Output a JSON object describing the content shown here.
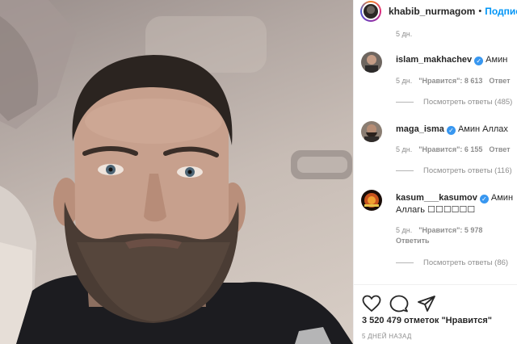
{
  "post": {
    "photo_alt": "selfie photo"
  },
  "header": {
    "username": "khabib_nurmagom",
    "separator": "•",
    "follow_label": "Подпис"
  },
  "top_comment_age": "5 дн.",
  "comments": [
    {
      "username": "islam_makhachev",
      "text": "Амин",
      "text2": "",
      "age": "5 дн.",
      "likes": "\"Нравится\": 8 613",
      "reply": "Ответ",
      "view_replies": "Посмотреть ответы (485)"
    },
    {
      "username": "maga_isma",
      "text": "Амин Аллах",
      "text2": "",
      "age": "5 дн.",
      "likes": "\"Нравится\": 6 155",
      "reply": "Ответ",
      "view_replies": "Посмотреть ответы (116)"
    },
    {
      "username": "kasum___kasumov",
      "text": "Амин",
      "text2": "Аллагь ☐☐☐☐☐☐",
      "age": "5 дн.",
      "likes": "\"Нравится\": 5 978",
      "reply": "Ответить",
      "view_replies": "Посмотреть ответы (86)"
    }
  ],
  "actions": {
    "like_icon": "heart-icon",
    "comment_icon": "comment-icon",
    "share_icon": "send-icon",
    "likes_text": "3 520 479 отметок \"Нравится\"",
    "post_age": "5 ДНЕЙ НАЗАД"
  },
  "colors": {
    "link_blue": "#0095f6",
    "verified_blue": "#3897f0",
    "secondary_text": "#8e8e8e"
  }
}
